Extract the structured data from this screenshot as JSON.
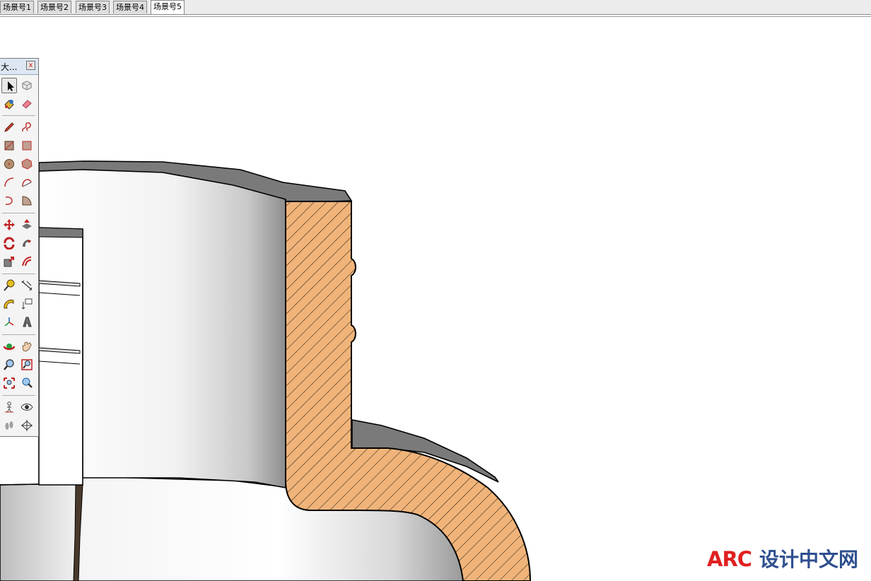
{
  "tabs": [
    {
      "label": "场景号1"
    },
    {
      "label": "场景号2"
    },
    {
      "label": "场景号3"
    },
    {
      "label": "场景号4"
    },
    {
      "label": "场景号5",
      "active": true
    }
  ],
  "palette": {
    "title": "大...",
    "close": "x",
    "tools": [
      "select-icon",
      "component-icon",
      "paint-bucket-icon",
      "eraser-icon",
      "pencil-icon",
      "freehand-icon",
      "rectangle-icon",
      "rotated-rectangle-icon",
      "circle-icon",
      "polygon-icon",
      "arc-icon",
      "two-point-arc-icon",
      "three-point-arc-icon",
      "pie-icon",
      "move-icon",
      "push-pull-icon",
      "rotate-icon",
      "follow-me-icon",
      "scale-icon",
      "offset-icon",
      "tape-measure-icon",
      "dimension-icon",
      "protractor-icon",
      "text-icon",
      "axes-icon",
      "3d-text-icon",
      "orbit-icon",
      "pan-icon",
      "zoom-icon",
      "zoom-window-icon",
      "zoom-extents-icon",
      "previous-view-icon",
      "position-camera-icon",
      "look-around-icon",
      "walk-icon",
      "section-plane-icon"
    ]
  },
  "colors": {
    "section_fill": "#f0b47a",
    "section_hatch": "#3a2a1a",
    "cap_gray": "#7a7a7a",
    "watermark_red": "#e02020",
    "watermark_blue": "#2f4f8f"
  },
  "watermark": {
    "logo": "ARC",
    "text": "设计中文网"
  }
}
